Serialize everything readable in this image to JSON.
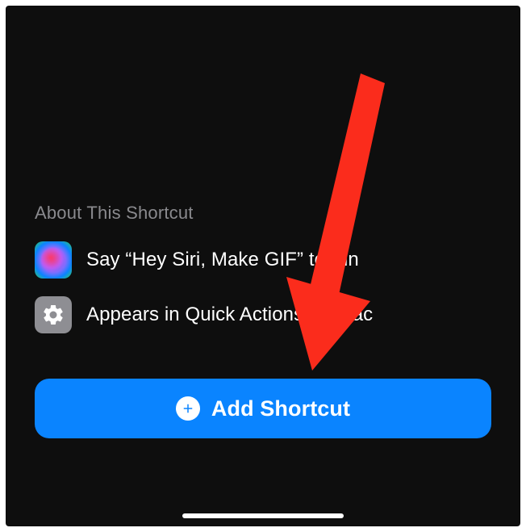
{
  "section": {
    "title": "About This Shortcut",
    "rows": [
      {
        "icon": "siri-icon",
        "text": "Say “Hey Siri, Make GIF” to run"
      },
      {
        "icon": "gear-icon",
        "text": "Appears in Quick Actions on Mac"
      }
    ]
  },
  "button": {
    "label": "Add Shortcut"
  },
  "colors": {
    "accent": "#0a84ff",
    "arrow": "#fb2c1c"
  }
}
